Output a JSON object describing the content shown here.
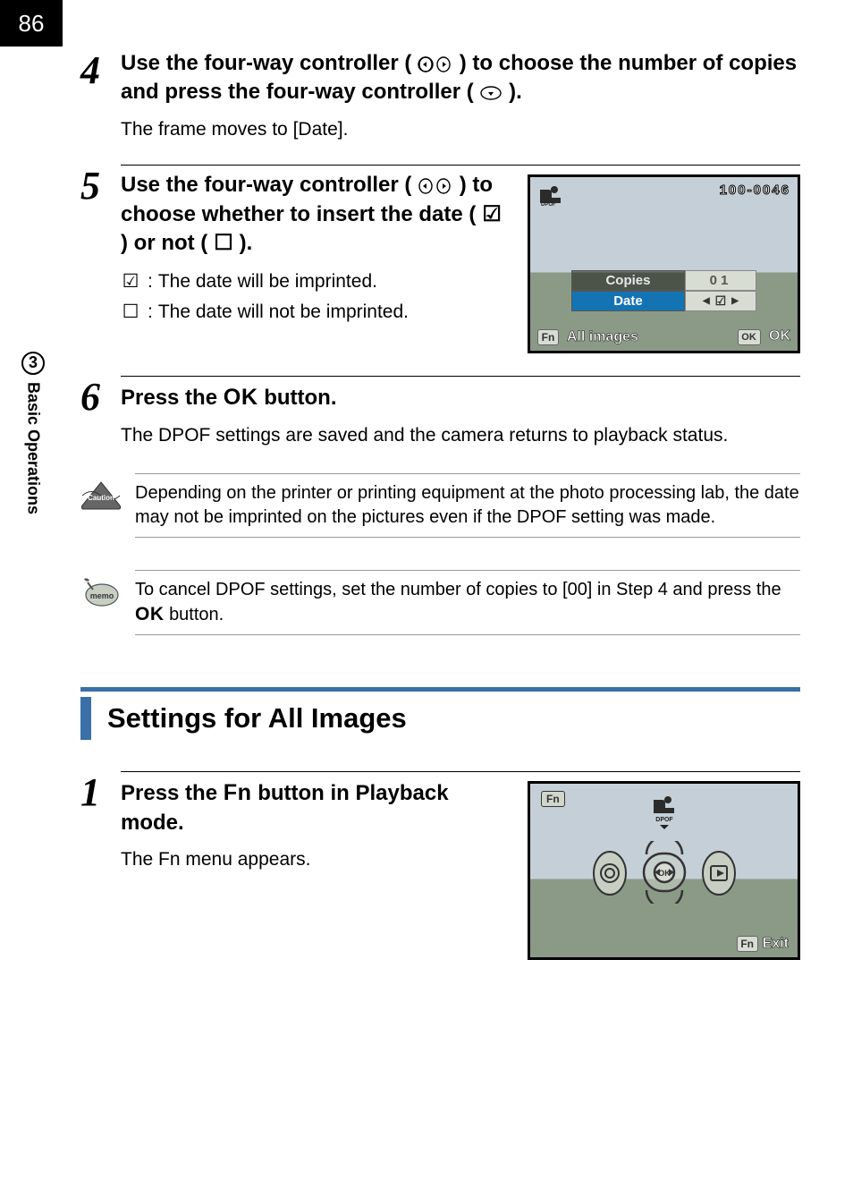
{
  "page_number": "86",
  "sidebar": {
    "chapter": "3",
    "label": "Basic Operations"
  },
  "step4": {
    "num": "4",
    "title_a": "Use the four-way controller (",
    "title_b": ") to choose the number of copies and press the four-way controller (",
    "title_c": ").",
    "detail": "The frame moves to [Date]."
  },
  "step5": {
    "num": "5",
    "title_a": "Use the four-way controller (",
    "title_b": ") to choose whether to insert the date (",
    "title_c": ") or not (",
    "title_d": ").",
    "item1_sym": "☑",
    "item1_text": "The date will be imprinted.",
    "item2_sym": "☐",
    "item2_text": "The date will not be imprinted."
  },
  "camera1": {
    "frame_number": "100-0046",
    "copies_label": "Copies",
    "copies_value": "01",
    "date_label": "Date",
    "all_images": "All images",
    "ok": "OK",
    "fn": "Fn",
    "ok_badge": "OK"
  },
  "step6": {
    "num": "6",
    "title_a": "Press the ",
    "title_b": " button.",
    "detail": "The DPOF settings are saved and the camera returns to playback status."
  },
  "caution": {
    "text": "Depending on the printer or printing equipment at the photo processing lab, the date may not be imprinted on the pictures even if the DPOF setting was made."
  },
  "memo": {
    "text_a": "To cancel DPOF settings, set the number of copies to [00] in Step 4 and press the ",
    "text_b": " button."
  },
  "section_title": "Settings for All Images",
  "step1b": {
    "num": "1",
    "title_a": "Press the ",
    "title_b": " button in Playback mode.",
    "fn_label": "Fn",
    "detail": "The Fn menu appears."
  },
  "camera2": {
    "fn": "Fn",
    "dpof": "DPOF",
    "exit": "Exit",
    "ok": "OK"
  }
}
